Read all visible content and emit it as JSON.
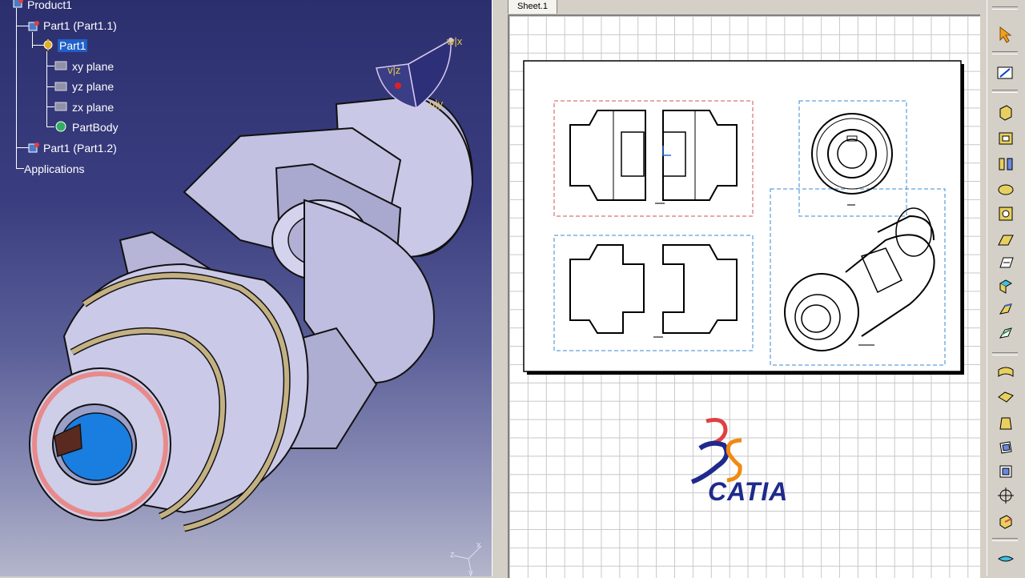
{
  "tree": {
    "product": "Product1",
    "part1_instance": "Part1 (Part1.1)",
    "part1": "Part1",
    "xy_plane": "xy plane",
    "yz_plane": "yz plane",
    "zx_plane": "zx plane",
    "partbody": "PartBody",
    "part2_instance": "Part1 (Part1.2)",
    "applications": "Applications"
  },
  "compass": {
    "w_x": "w|x",
    "v_z": "v|z",
    "u_y": "u|y"
  },
  "axis": {
    "x": "x",
    "y": "y",
    "z": "z"
  },
  "drawing": {
    "sheet_tab": "Sheet.1"
  },
  "logo": {
    "text": "CATIA",
    "ds": "DS"
  },
  "colors": {
    "viewport_top": "#2c2f6e",
    "viewport_bottom": "#b4b6cc",
    "part_fill": "#c9c8e6",
    "ring_gold": "#b8a57a",
    "ring_pink": "#e88a8a",
    "bore_blue": "#1a7de0",
    "view_red": "#d05050",
    "view_blue": "#3a8ad0"
  },
  "toolbar_icons": [
    "select-arrow-icon",
    "sketcher-icon",
    "pad-icon",
    "pocket-icon",
    "shaft-icon",
    "groove-icon",
    "hole-icon",
    "rib-icon",
    "slot-icon",
    "stiffener-icon",
    "multi-section-solid-icon",
    "removed-multi-section-icon",
    "fillet-icon",
    "chamfer-icon",
    "draft-icon",
    "shell-icon",
    "thickness-icon",
    "thread-icon",
    "remove-face-icon",
    "surface-icon"
  ]
}
